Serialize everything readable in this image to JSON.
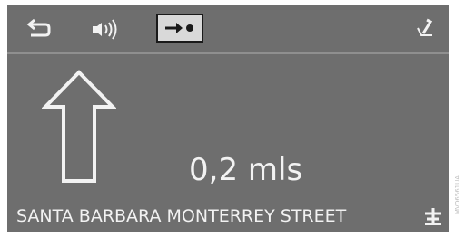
{
  "guidance": {
    "distance": "0,2 mls",
    "street": "SANTA BARBARA MONTERREY STREET"
  },
  "icons": {
    "back": "back-arrow-icon",
    "voice": "speaker-volume-icon",
    "route_mode": "arrow-to-destination-icon",
    "pin": "pin-icon",
    "maneuver": "straight-arrow-icon",
    "highway": "highway-junction-icon"
  },
  "colors": {
    "screen_bg": "#6e6e6e",
    "foreground": "#f2f2f2",
    "selected_bg": "#d9d9d9"
  },
  "image_code": "MV06561UA"
}
